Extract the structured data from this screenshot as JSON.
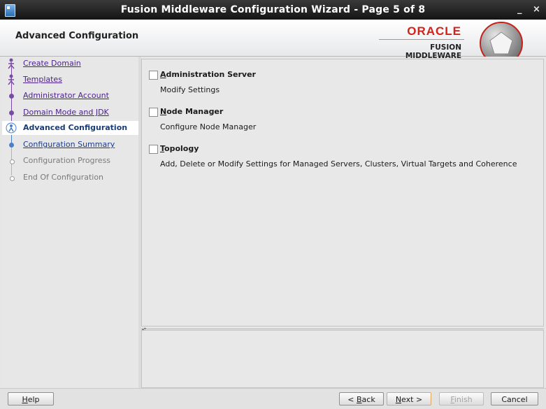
{
  "window": {
    "title": "Fusion Middleware Configuration Wizard - Page 5 of 8",
    "minimize_glyph": "_",
    "close_glyph": "×"
  },
  "header": {
    "step_title": "Advanced Configuration",
    "brand_oracle": "ORACLE",
    "brand_sub": "FUSION MIDDLEWARE"
  },
  "nav": {
    "items": [
      {
        "label": "Create Domain",
        "state": "done"
      },
      {
        "label": "Templates",
        "state": "done"
      },
      {
        "label": "Administrator Account",
        "state": "done"
      },
      {
        "label": "Domain Mode and JDK",
        "state": "done"
      },
      {
        "label": "Advanced Configuration",
        "state": "current"
      },
      {
        "label": "Configuration Summary",
        "state": "next"
      },
      {
        "label": "Configuration Progress",
        "state": "future"
      },
      {
        "label": "End Of Configuration",
        "state": "future"
      }
    ]
  },
  "options": [
    {
      "mnemonic": "A",
      "rest": "dministration Server",
      "description": "Modify Settings",
      "checked": false
    },
    {
      "mnemonic": "N",
      "rest": "ode Manager",
      "description": "Configure Node Manager",
      "checked": false
    },
    {
      "mnemonic": "T",
      "rest": "opology",
      "description": "Add, Delete or Modify Settings for Managed Servers, Clusters, Virtual Targets and Coherence",
      "checked": false
    }
  ],
  "buttons": {
    "help": {
      "mnemonic": "H",
      "rest": "elp"
    },
    "back": {
      "prefix": "< ",
      "mnemonic": "B",
      "rest": "ack"
    },
    "next": {
      "mnemonic": "N",
      "rest": "ext >"
    },
    "finish": {
      "mnemonic": "F",
      "rest": "inish"
    },
    "cancel": {
      "prefix": "",
      "label": "Cancel"
    }
  },
  "colors": {
    "oracle_red": "#d2231a",
    "visited_link": "#4a1f8a",
    "current_step": "#1a3b73",
    "default_button_border": "#e3a55a"
  }
}
